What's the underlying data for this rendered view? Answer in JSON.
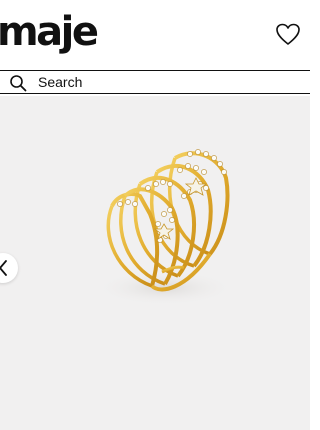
{
  "header": {
    "logo_text": "maje",
    "wishlist_icon": "heart-icon"
  },
  "search": {
    "label": "Search",
    "icon": "search-icon"
  },
  "gallery": {
    "prev_icon": "chevron-left-icon",
    "background_color": "#f1f0f0",
    "product_color": "#e5b53a"
  }
}
